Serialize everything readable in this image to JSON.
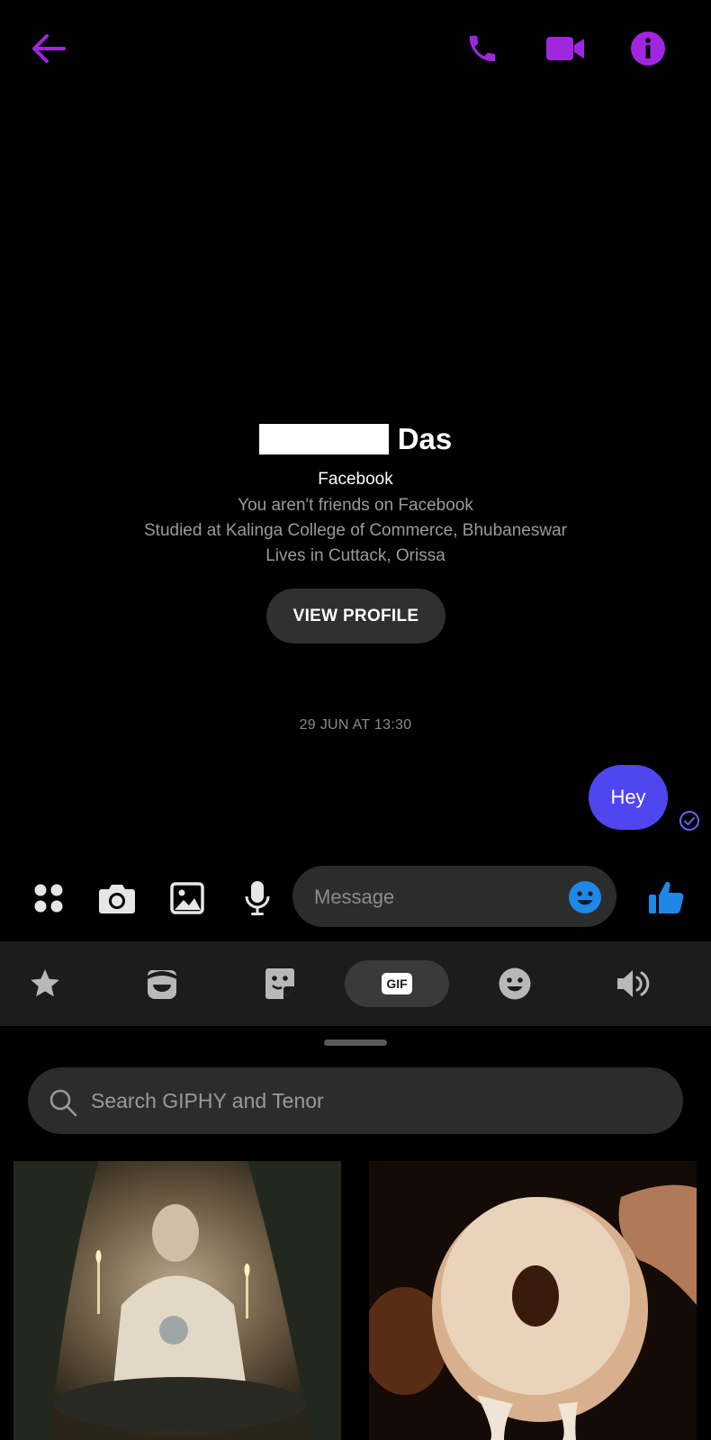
{
  "header": {
    "back_icon": "arrow-left-icon",
    "call_icon": "phone-icon",
    "video_icon": "video-camera-icon",
    "info_icon": "info-icon",
    "accent": "#a026e0"
  },
  "profile": {
    "surname": "Das",
    "platform": "Facebook",
    "friend_status": "You aren't friends on Facebook",
    "education": "Studied at Kalinga College of Commerce, Bhubaneswar",
    "location": "Lives in Cuttack, Orissa",
    "view_profile_label": "VIEW PROFILE"
  },
  "conversation": {
    "timestamp": "29 JUN AT 13:30",
    "messages": [
      {
        "text": "Hey",
        "sender": "me",
        "status": "sent"
      }
    ],
    "bubble_color": "#5046f0"
  },
  "composer": {
    "placeholder": "Message",
    "icons": [
      "apps-icon",
      "camera-icon",
      "gallery-icon",
      "microphone-icon",
      "emoji-icon",
      "thumbs-up-icon"
    ],
    "accent": "#1e88e5"
  },
  "tray": {
    "tabs": [
      "favorites",
      "avatar-stickers",
      "stickers",
      "GIF",
      "emoji",
      "sound"
    ],
    "active_tab": "GIF",
    "gif_label": "GIF",
    "search_placeholder": "Search GIPHY and Tenor",
    "results": [
      {
        "name": "gif-fortune-teller"
      },
      {
        "name": "gif-glazed-donut"
      }
    ]
  }
}
